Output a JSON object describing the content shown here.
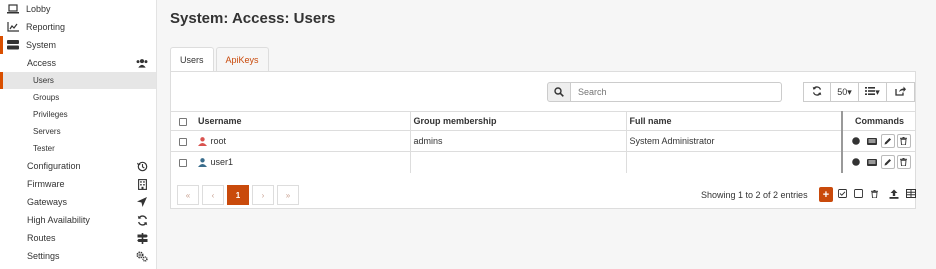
{
  "sidebar": {
    "items": [
      {
        "label": "Lobby",
        "icon": "laptop-icon"
      },
      {
        "label": "Reporting",
        "icon": "chart-icon"
      },
      {
        "label": "System",
        "icon": "server-icon"
      }
    ],
    "system_children": [
      {
        "label": "Access",
        "icon": "users-icon"
      },
      {
        "label": "Configuration",
        "icon": "history-icon"
      },
      {
        "label": "Firmware",
        "icon": "building-icon"
      },
      {
        "label": "Gateways",
        "icon": "location-arrow-icon"
      },
      {
        "label": "High Availability",
        "icon": "refresh-icon"
      },
      {
        "label": "Routes",
        "icon": "signpost-icon"
      },
      {
        "label": "Settings",
        "icon": "cogs-icon"
      }
    ],
    "access_children": [
      "Users",
      "Groups",
      "Privileges",
      "Servers",
      "Tester"
    ]
  },
  "page": {
    "title": "System: Access: Users"
  },
  "tabs": [
    {
      "label": "Users",
      "active": true
    },
    {
      "label": "ApiKeys",
      "active": false
    }
  ],
  "search": {
    "placeholder": "Search",
    "value": ""
  },
  "toolbar": {
    "rows_per_page": "50"
  },
  "table": {
    "columns": [
      "Username",
      "Group membership",
      "Full name",
      "Commands"
    ],
    "rows": [
      {
        "username": "root",
        "group": "admins",
        "full_name": "System Administrator",
        "icon_color": "#d9534f"
      },
      {
        "username": "user1",
        "group": "",
        "full_name": "",
        "icon_color": "#3a6d8c"
      }
    ]
  },
  "pagination": {
    "first": "«",
    "prev": "‹",
    "current": "1",
    "next": "›",
    "last": "»",
    "summary": "Showing 1 to 2 of 2 entries"
  },
  "colors": {
    "accent": "#c94a0b",
    "active_indicator": "#d94f00"
  }
}
